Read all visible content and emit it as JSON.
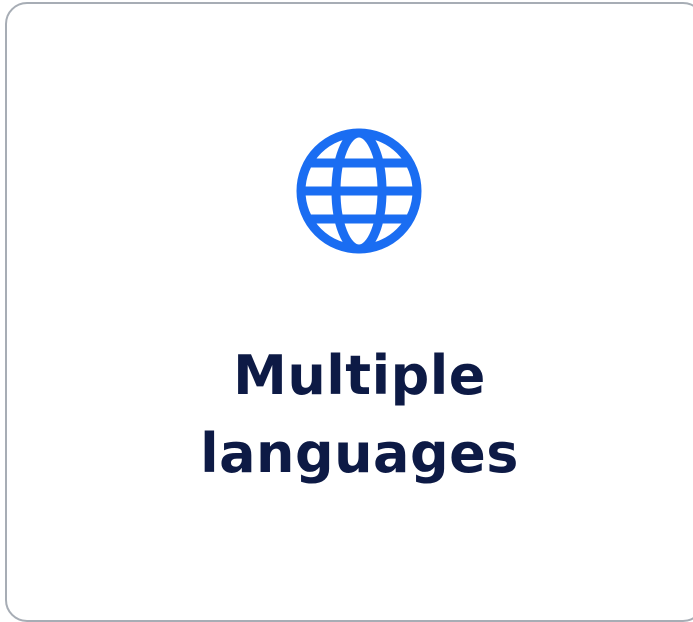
{
  "card": {
    "icon": "globe-icon",
    "accent_color": "#1a6df2",
    "title_line1": "Multiple",
    "title_line2": "languages"
  }
}
